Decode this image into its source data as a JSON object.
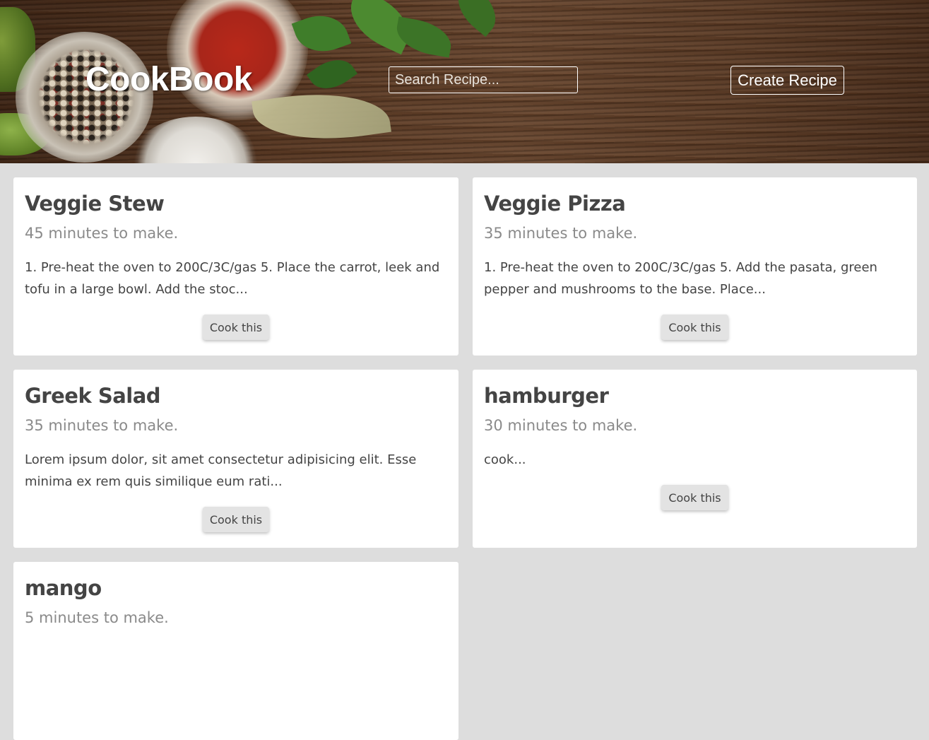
{
  "header": {
    "brand": "CookBook",
    "search_placeholder": "Search Recipe...",
    "create_label": "Create Recipe"
  },
  "recipes": [
    {
      "title": "Veggie Stew",
      "time": "45 minutes to make.",
      "excerpt": "1. Pre-heat the oven to 200C/3C/gas 5. Place the carrot, leek and tofu in a large bowl. Add the stoc...",
      "button": "Cook this"
    },
    {
      "title": "Veggie Pizza",
      "time": "35 minutes to make.",
      "excerpt": "1. Pre-heat the oven to 200C/3C/gas 5. Add the pasata, green pepper and mushrooms to the base. Place...",
      "button": "Cook this"
    },
    {
      "title": "Greek Salad",
      "time": "35 minutes to make.",
      "excerpt": "Lorem ipsum dolor, sit amet consectetur adipisicing elit. Esse minima ex rem quis similique eum rati...",
      "button": "Cook this"
    },
    {
      "title": "hamburger",
      "time": "30 minutes to make.",
      "excerpt": "cook...",
      "button": "Cook this"
    },
    {
      "title": "mango",
      "time": "5 minutes to make.",
      "excerpt": "",
      "button": ""
    }
  ]
}
